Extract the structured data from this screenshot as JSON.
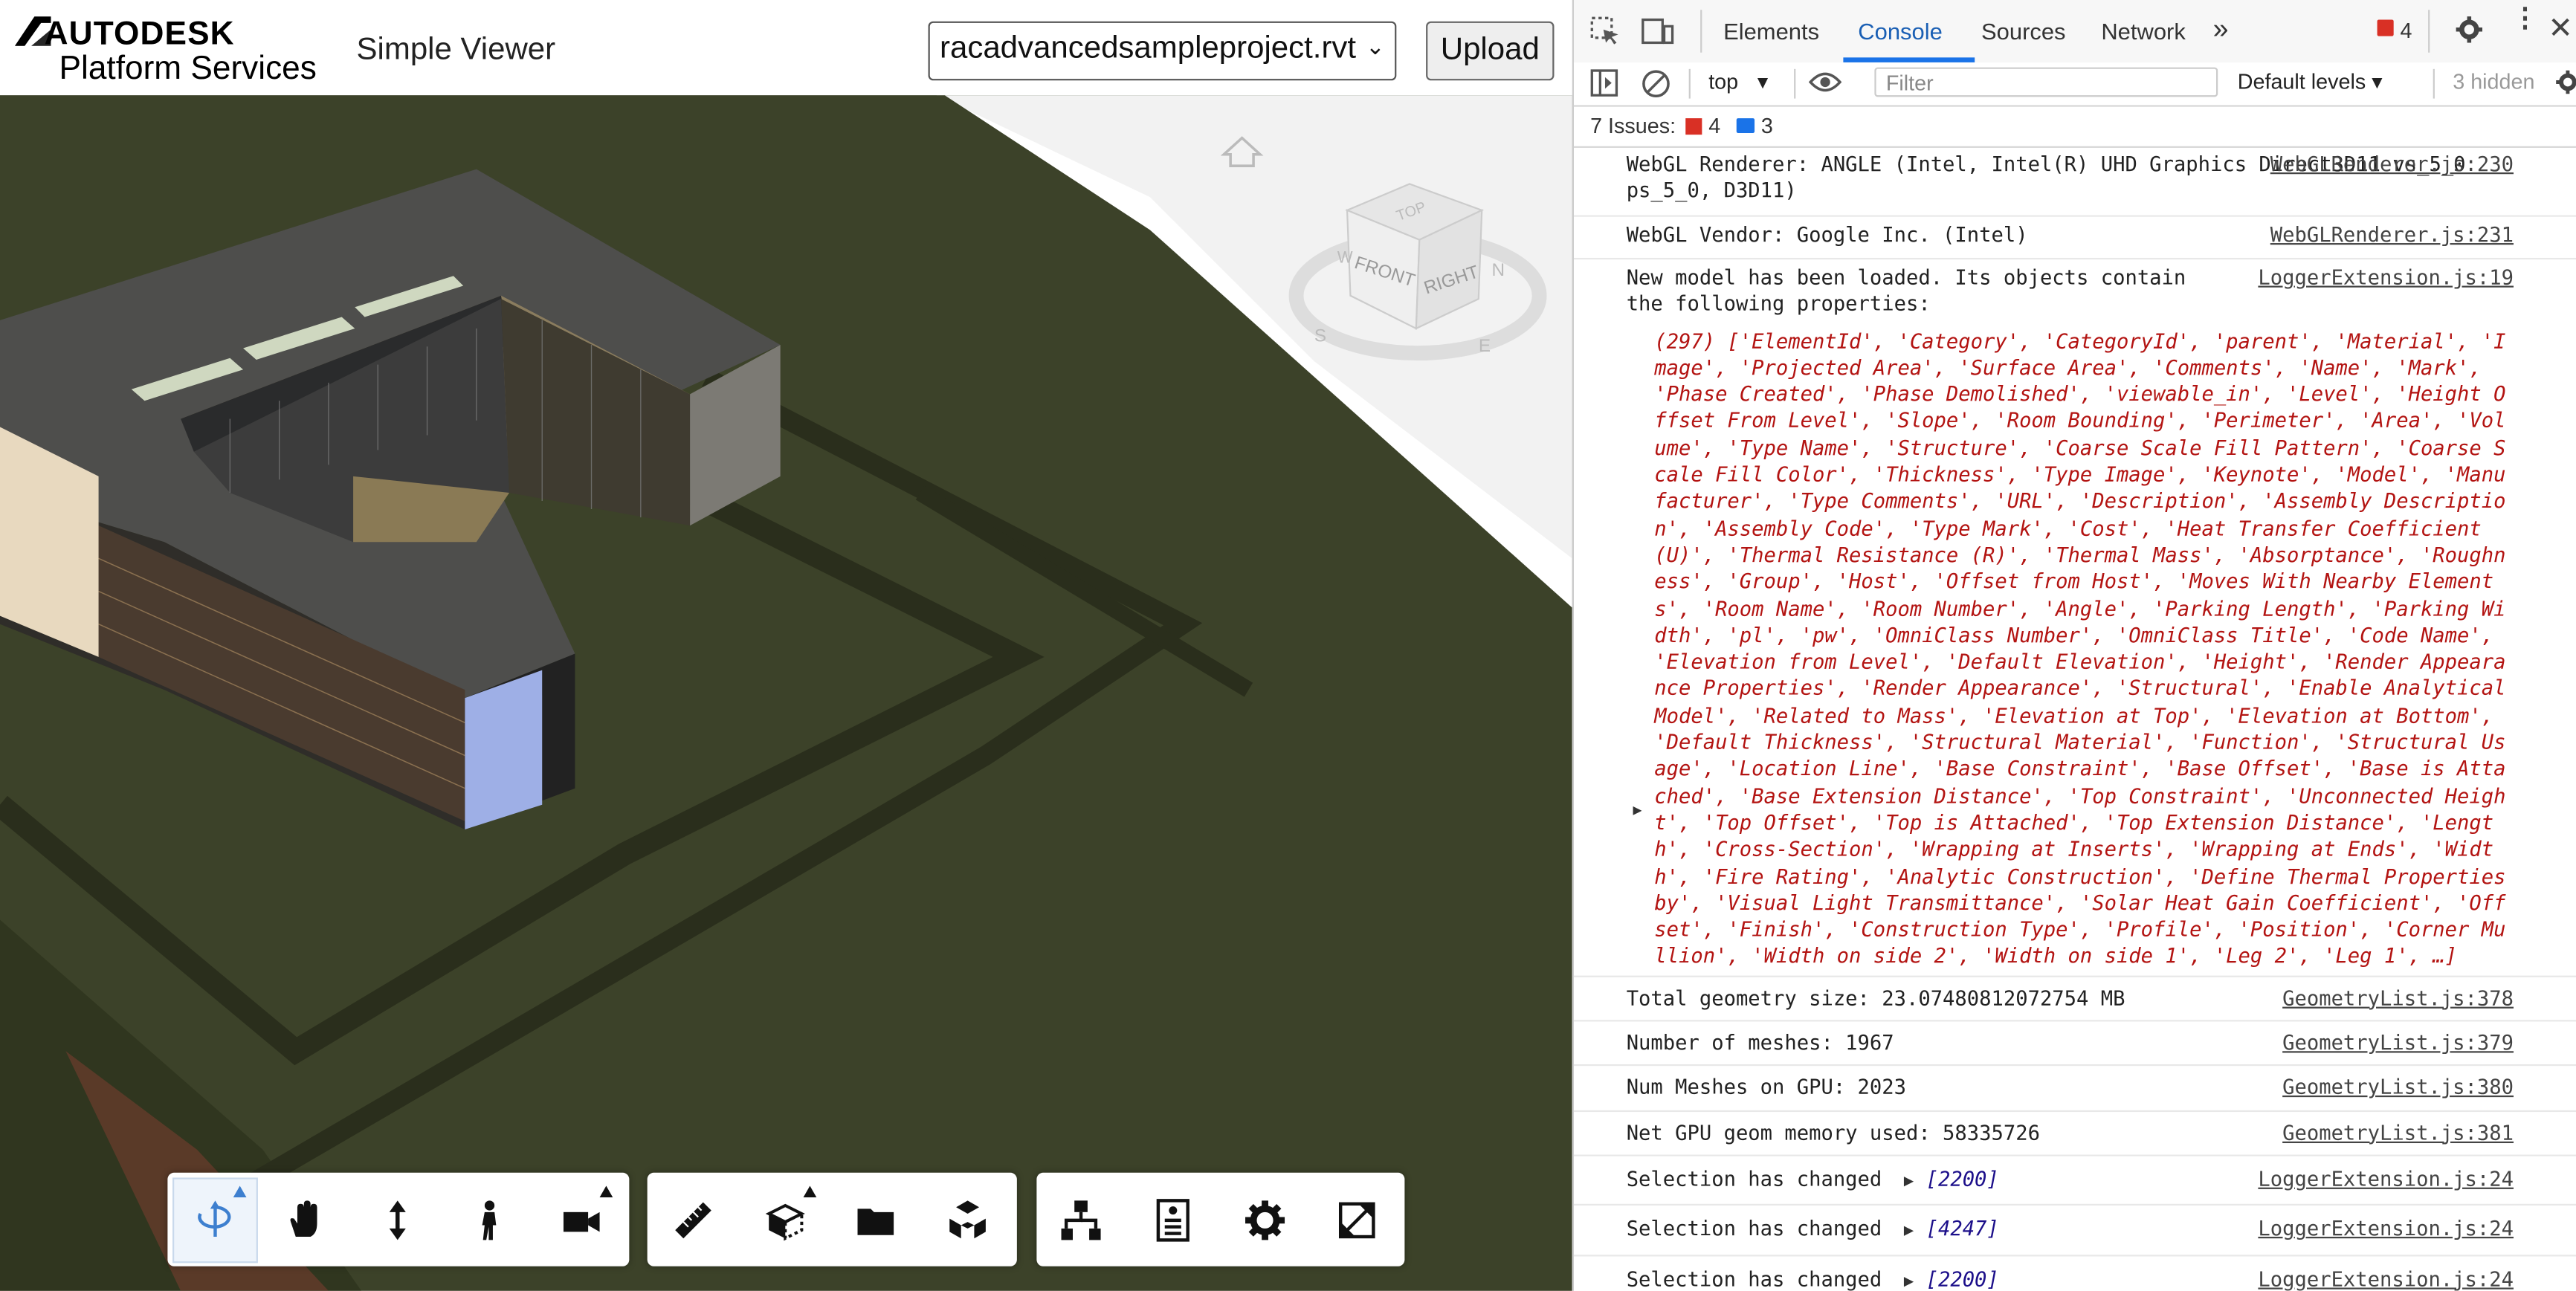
{
  "header": {
    "logo_line1": "AUTODESK",
    "logo_line2": "Platform Services",
    "app_title": "Simple Viewer",
    "model_select_value": "racadvancedsampleproject.rvt",
    "upload_label": "Upload"
  },
  "viewcube": {
    "top": "TOP",
    "front": "FRONT",
    "right": "RIGHT",
    "n": "N",
    "s": "S",
    "e": "E",
    "w": "W"
  },
  "toolbar": {
    "groups": [
      [
        "orbit-icon",
        "pan-hand-icon",
        "vertical-arrows-icon",
        "walk-person-icon",
        "camera-icon"
      ],
      [
        "ruler-icon",
        "section-box-icon",
        "folder-icon",
        "explode-cubes-icon"
      ],
      [
        "model-tree-icon",
        "properties-icon",
        "gear-icon",
        "fullscreen-icon"
      ]
    ]
  },
  "devtools": {
    "tabs": [
      "Elements",
      "Console",
      "Sources",
      "Network"
    ],
    "selected_tab": "Console",
    "more": "»",
    "error_count": "4",
    "context": "top",
    "filter_placeholder": "Filter",
    "levels": "Default levels",
    "hidden": "3 hidden",
    "issues_label": "7 Issues:",
    "issues_errors": "4",
    "issues_info": "3",
    "logs": [
      {
        "text": "WebGL Renderer: ANGLE (Intel, Intel(R) UHD Graphics Direct3D11 vs_5_0 ps_5_0, D3D11)",
        "src": "WebGLRenderer.js:230"
      },
      {
        "text": "WebGL Vendor: Google Inc. (Intel)",
        "src": "WebGLRenderer.js:231"
      },
      {
        "text": "New model has been loaded. Its objects contain the following properties:",
        "src": "LoggerExtension.js:19"
      }
    ],
    "property_array": "(297) ['ElementId', 'Category', 'CategoryId', 'parent', 'Material', 'Image', 'Projected Area', 'Surface Area', 'Comments', 'Name', 'Mark', 'Phase Created', 'Phase Demolished', 'viewable_in', 'Level', 'Height Offset From Level', 'Slope', 'Room Bounding', 'Perimeter', 'Area', 'Volume', 'Type Name', 'Structure', 'Coarse Scale Fill Pattern', 'Coarse Scale Fill Color', 'Thickness', 'Type Image', 'Keynote', 'Model', 'Manufacturer', 'Type Comments', 'URL', 'Description', 'Assembly Description', 'Assembly Code', 'Type Mark', 'Cost', 'Heat Transfer Coefficient (U)', 'Thermal Resistance (R)', 'Thermal Mass', 'Absorptance', 'Roughness', 'Group', 'Host', 'Offset from Host', 'Moves With Nearby Elements', 'Room Name', 'Room Number', 'Angle', 'Parking Length', 'Parking Width', 'pl', 'pw', 'OmniClass Number', 'OmniClass Title', 'Code Name', 'Elevation from Level', 'Default Elevation', 'Height', 'Render Appearance Properties', 'Render Appearance', 'Structural', 'Enable Analytical Model', 'Related to Mass', 'Elevation at Top', 'Elevation at Bottom', 'Default Thickness', 'Structural Material', 'Function', 'Structural Usage', 'Location Line', 'Base Constraint', 'Base Offset', 'Base is Attached', 'Base Extension Distance', 'Top Constraint', 'Unconnected Height', 'Top Offset', 'Top is Attached', 'Top Extension Distance', 'Length', 'Cross-Section', 'Wrapping at Inserts', 'Wrapping at Ends', 'Width', 'Fire Rating', 'Analytic Construction', 'Define Thermal Properties by', 'Visual Light Transmittance', 'Solar Heat Gain Coefficient', 'Offset', 'Finish', 'Construction Type', 'Profile', 'Position', 'Corner Mullion', 'Width on side 2', 'Width on side 1', 'Leg 2', 'Leg 1', …]",
    "stats": [
      {
        "text": "Total geometry size: 23.07480812072754 MB",
        "src": "GeometryList.js:378"
      },
      {
        "text": "Number of meshes: 1967",
        "src": "GeometryList.js:379"
      },
      {
        "text": "Num Meshes on GPU: 2023",
        "src": "GeometryList.js:380"
      },
      {
        "text": "Net GPU geom memory used: 58335726",
        "src": "GeometryList.js:381"
      }
    ],
    "selections": [
      {
        "text": "Selection has changed",
        "value": "[2200]",
        "src": "LoggerExtension.js:24"
      },
      {
        "text": "Selection has changed",
        "value": "[4247]",
        "src": "LoggerExtension.js:24"
      },
      {
        "text": "Selection has changed",
        "value": "[2200]",
        "src": "LoggerExtension.js:24"
      }
    ],
    "prompt": "›"
  },
  "colors": {
    "accent": "#1a73e8",
    "error_red": "#b31412",
    "ground": "#3b4228"
  }
}
